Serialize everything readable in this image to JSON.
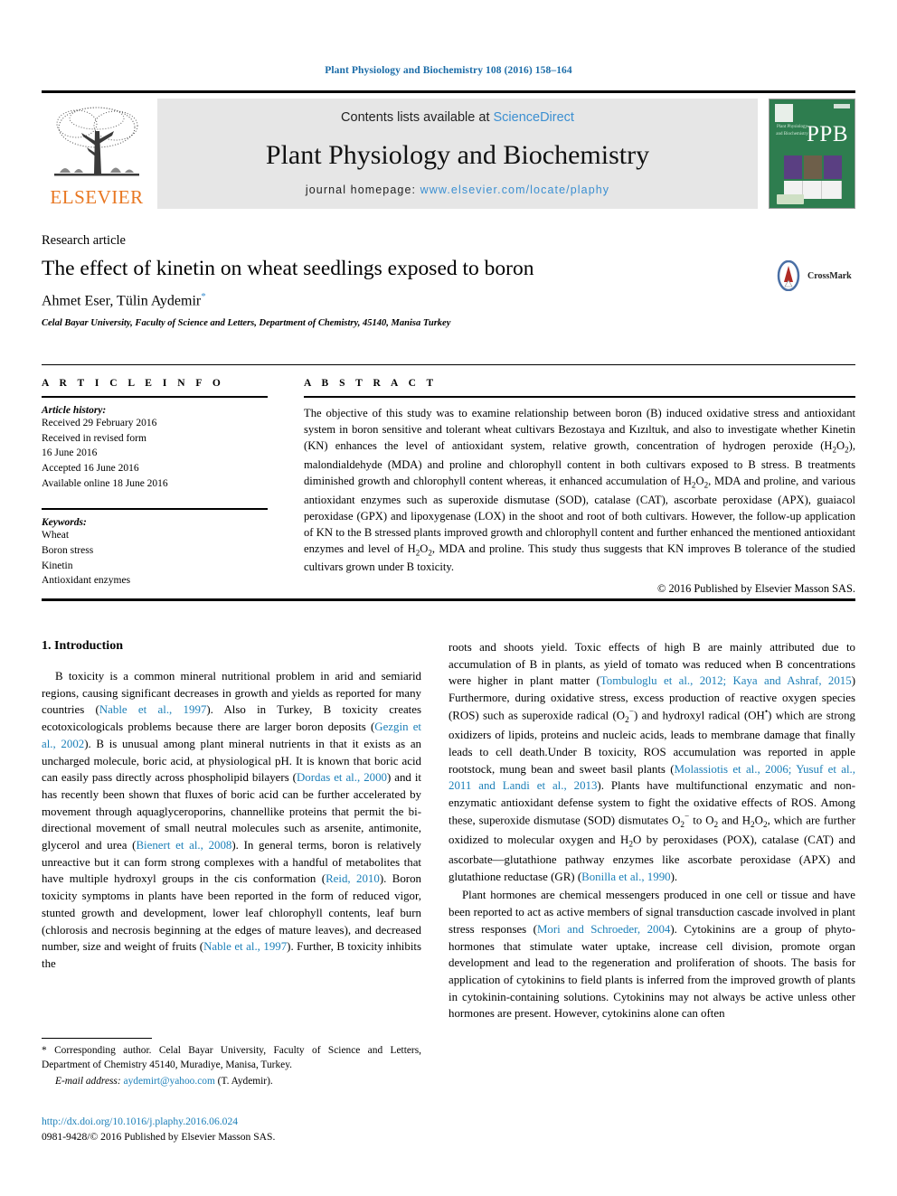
{
  "running_head": "Plant Physiology and Biochemistry 108 (2016) 158–164",
  "masthead": {
    "publisher_name": "ELSEVIER",
    "contents_prefix": "Contents lists available at ",
    "contents_link": "ScienceDirect",
    "journal_title": "Plant Physiology and Biochemistry",
    "homepage_label": "journal homepage: ",
    "homepage_url": "www.elsevier.com/locate/plaphy",
    "cover": {
      "abbrev": "PPB",
      "title_lines": "Plant Physiology and Biochemistry"
    }
  },
  "article": {
    "type": "Research article",
    "title": "The effect of kinetin on wheat seedlings exposed to boron",
    "authors": "Ahmet Eser, Tülin Aydemir",
    "corresponding_marker": "*",
    "affiliation": "Celal Bayar University, Faculty of Science and Letters, Department of Chemistry, 45140, Manisa Turkey",
    "crossmark_label": "CrossMark"
  },
  "info": {
    "heading": "A R T I C L E   I N F O",
    "history_label": "Article history:",
    "history": [
      "Received 29 February 2016",
      "Received in revised form",
      "16 June 2016",
      "Accepted 16 June 2016",
      "Available online 18 June 2016"
    ],
    "keywords_label": "Keywords:",
    "keywords": [
      "Wheat",
      "Boron stress",
      "Kinetin",
      "Antioxidant enzymes"
    ]
  },
  "abstract": {
    "heading": "A B S T R A C T",
    "text": "The objective of this study was to examine relationship between boron (B) induced oxidative stress and antioxidant system in boron sensitive and tolerant wheat cultivars Bezostaya and Kızıltuk, and also to investigate whether Kinetin (KN) enhances the level of antioxidant system, relative growth, concentration of hydrogen peroxide (H2O2), malondialdehyde (MDA) and proline and chlorophyll content in both cultivars exposed to B stress. B treatments diminished growth and chlorophyll content whereas, it enhanced accumulation of H2O2, MDA and proline, and various antioxidant enzymes such as superoxide dismutase (SOD), catalase (CAT), ascorbate peroxidase (APX), guaiacol peroxidase (GPX) and lipoxygenase (LOX) in the shoot and root of both cultivars. However, the follow-up application of KN to the B stressed plants improved growth and chlorophyll content and further enhanced the mentioned antioxidant enzymes and level of H2O2, MDA and proline. This study thus suggests that KN improves B tolerance of the studied cultivars grown under B toxicity.",
    "copyright": "© 2016 Published by Elsevier Masson SAS."
  },
  "sections": {
    "introduction_heading": "1.  Introduction",
    "left_paragraph_1": "B toxicity is a common mineral nutritional problem in arid and semiarid regions, causing significant decreases in growth and yields as reported for many countries (Nable et al., 1997). Also in Turkey, B toxicity creates ecotoxicologicals problems because there are larger boron deposits (Gezgin et al., 2002). B is unusual among plant mineral nutrients in that it exists as an uncharged molecule, boric acid, at physiological pH. It is known that boric acid can easily pass directly across phospholipid bilayers (Dordas et al., 2000) and it has recently been shown that fluxes of boric acid can be further accelerated by movement through aquaglyceroporins, channellike proteins that permit the bi-directional movement of small neutral molecules such as arsenite, antimonite, glycerol and urea (Bienert et al., 2008). In general terms, boron is relatively unreactive but it can form strong complexes with a handful of metabolites that have multiple hydroxyl groups in the cis conformation (Reid, 2010). Boron toxicity symptoms in plants have been reported in the form of reduced vigor, stunted growth and development, lower leaf chlorophyll contents, leaf burn (chlorosis and necrosis beginning at the edges of mature leaves), and decreased number, size and weight of fruits (Nable et al., 1997). Further, B toxicity inhibits the",
    "right_paragraph_1": "roots and shoots yield. Toxic effects of high B are mainly attributed due to accumulation of B in plants, as yield of tomato was reduced when B concentrations were higher in plant matter (Tombuloglu et al., 2012; Kaya and Ashraf, 2015) Furthermore, during oxidative stress, excess production of reactive oxygen species (ROS) such as superoxide radical (O2-) and hydroxyl radical (OH-) which are strong oxidizers of lipids, proteins and nucleic acids, leads to membrane damage that finally leads to cell death.Under B toxicity, ROS accumulation was reported in apple rootstock, mung bean and sweet basil plants (Molassiotis et al., 2006; Yusuf et al., 2011 and Landi et al., 2013). Plants have multifunctional enzymatic and non-enzymatic antioxidant defense system to fight the oxidative effects of ROS. Among these, superoxide dismutase (SOD) dismutates O2- to O2 and H2O2, which are further oxidized to molecular oxygen and H2O by peroxidases (POX), catalase (CAT) and ascorbate—glutathione pathway enzymes like ascorbate peroxidase (APX) and glutathione reductase (GR) (Bonilla et al., 1990).",
    "right_paragraph_2": "Plant hormones are chemical messengers produced in one cell or tissue and have been reported to act as active members of signal transduction cascade involved in plant stress responses (Mori and Schroeder, 2004). Cytokinins are a group of phyto-hormones that stimulate water uptake, increase cell division, promote organ development and lead to the regeneration and proliferation of shoots. The basis for application of cytokinins to field plants is inferred from the improved growth of plants in cytokinin-containing solutions. Cytokinins may not always be active unless other hormones are present. However, cytokinins alone can often"
  },
  "footnote": {
    "corresponding": "* Corresponding author. Celal Bayar University, Faculty of Science and Letters, Department of Chemistry 45140, Muradiye, Manisa, Turkey.",
    "email_label": "E-mail address:",
    "email": "aydemirt@yahoo.com",
    "email_suffix": "(T. Aydemir).",
    "doi": "http://dx.doi.org/10.1016/j.plaphy.2016.06.024",
    "issn_line": "0981-9428/© 2016 Published by Elsevier Masson SAS."
  },
  "colors": {
    "link_blue": "#1b7fb8",
    "elsevier_orange": "#e87722",
    "cover_green": "#2e7d4f",
    "masthead_grey": "#e6e6e6"
  }
}
